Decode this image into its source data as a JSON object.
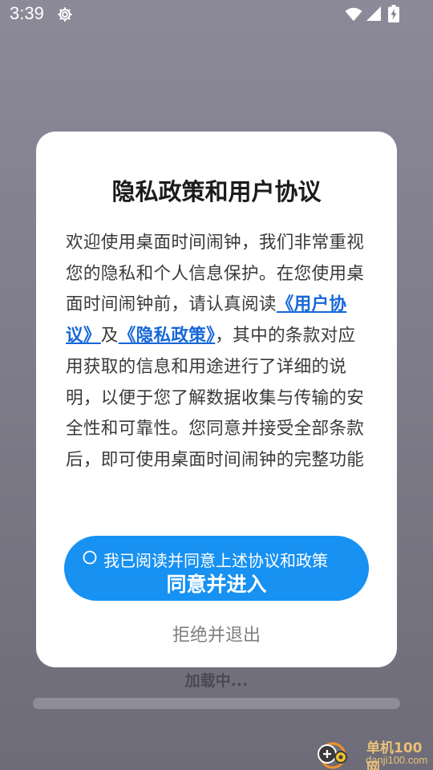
{
  "status_bar": {
    "time": "3:39",
    "icons": [
      "settings-icon",
      "wifi-icon",
      "signal-icon",
      "battery-charging-icon"
    ]
  },
  "background": {
    "loading_text": "加载中...",
    "progress": 0
  },
  "dialog": {
    "title": "隐私政策和用户协议",
    "body_before_links": "欢迎使用桌面时间闹钟，我们非常重视您的隐私和个人信息保护。在您使用桌面时间闹钟前，请认真阅读",
    "user_agreement_link": "《用户协议》",
    "conjunction": "及",
    "privacy_policy_link": "《隐私政策》",
    "body_after_links": "，其中的条款对应用获取的信息和用途进行了详细的说明，以便于您了解数据收集与传输的安全性和可靠性。您同意并接受全部条款后，即可使用桌面时间闹钟的完整功能",
    "checkbox_label": "我已阅读并同意上述协议和政策",
    "checkbox_checked": false,
    "agree_button_label": "同意并进入",
    "reject_button_label": "拒绝并退出"
  },
  "watermark": {
    "name": "单机100网",
    "url": "danji100.com"
  },
  "colors": {
    "accent": "#1791f2",
    "link": "#1567d8",
    "dialog_background": "#ffffff",
    "watermark": "#e9c078"
  }
}
